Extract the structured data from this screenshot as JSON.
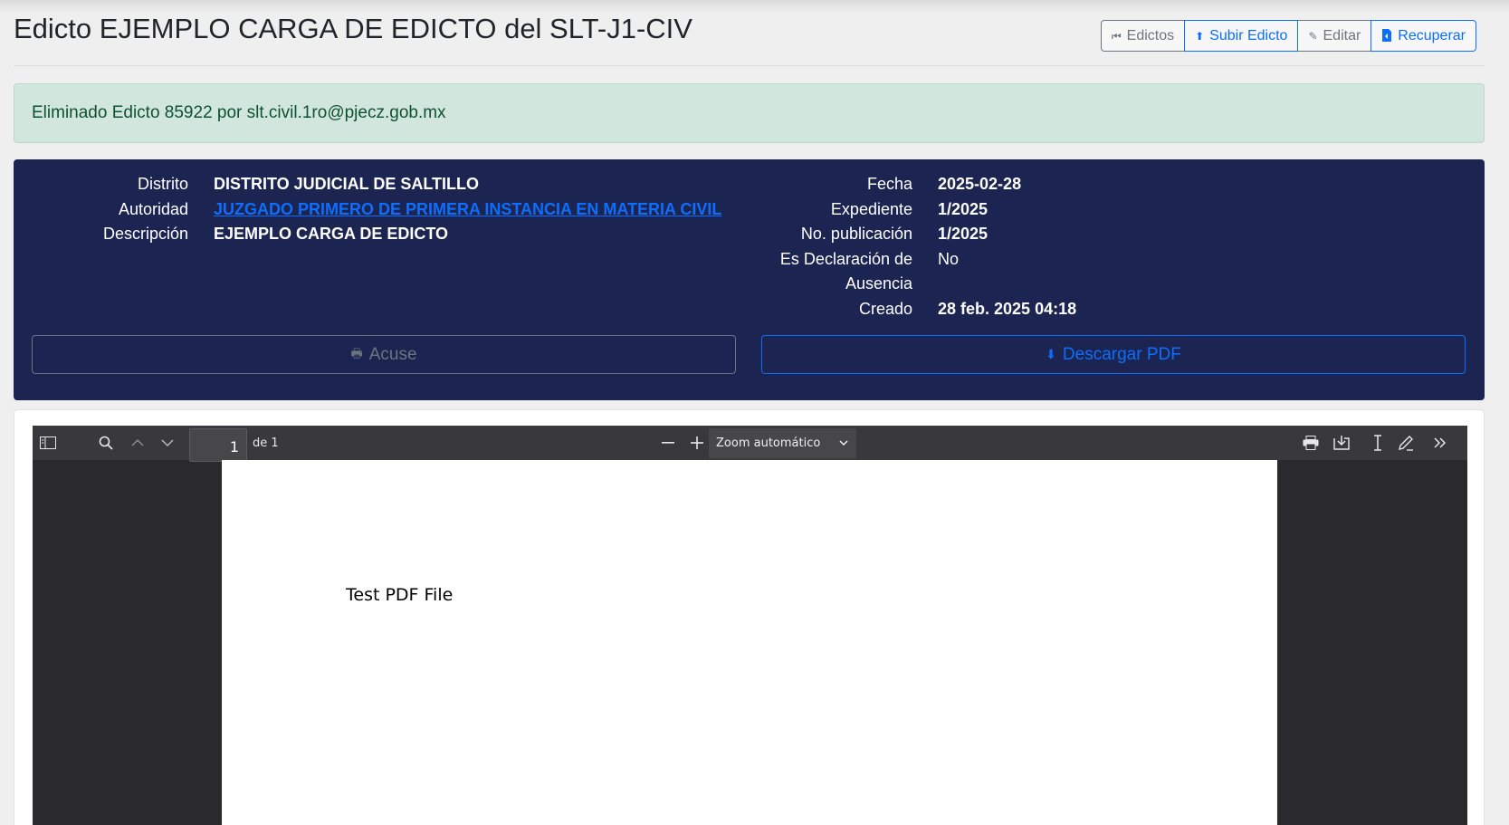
{
  "page": {
    "title": "Edicto EJEMPLO CARGA DE EDICTO del SLT-J1-CIV"
  },
  "header_buttons": [
    {
      "label": "Edictos",
      "icon": "skip-back-icon",
      "style": "secondary"
    },
    {
      "label": "Subir Edicto",
      "icon": "upload-icon",
      "style": "primary"
    },
    {
      "label": "Editar",
      "icon": "pencil-icon",
      "style": "secondary"
    },
    {
      "label": "Recuperar",
      "icon": "document-restore-icon",
      "style": "primary"
    }
  ],
  "alert": {
    "message": "Eliminado Edicto 85922 por slt.civil.1ro@pjecz.gob.mx"
  },
  "details_left": [
    {
      "label": "Distrito",
      "value": "DISTRITO JUDICIAL DE SALTILLO"
    },
    {
      "label": "Autoridad",
      "value": "JUZGADO PRIMERO DE PRIMERA INSTANCIA EN MATERIA CIVIL"
    },
    {
      "label": "Descripción",
      "value": "EJEMPLO CARGA DE EDICTO"
    }
  ],
  "details_right": [
    {
      "label": "Fecha",
      "value": "2025-02-28"
    },
    {
      "label": "Expediente",
      "value": "1/2025"
    },
    {
      "label": "No. publicación",
      "value": "1/2025"
    },
    {
      "label": "Es Declaración de Ausencia",
      "value": "No"
    },
    {
      "label": "Creado",
      "value": "28 feb. 2025 04:18"
    }
  ],
  "actions": {
    "acuse_label": "Acuse",
    "download_label": "Descargar PDF"
  },
  "pdf_viewer": {
    "current_page": "1",
    "page_of": "de 1",
    "zoom": "Zoom automático",
    "document_text": "Test PDF File"
  },
  "colors": {
    "primary": "#0d6efd",
    "secondary": "#6c757d",
    "card_bg": "#1c2552",
    "alert_bg": "#d1e7dd",
    "alert_text": "#0f5132"
  }
}
